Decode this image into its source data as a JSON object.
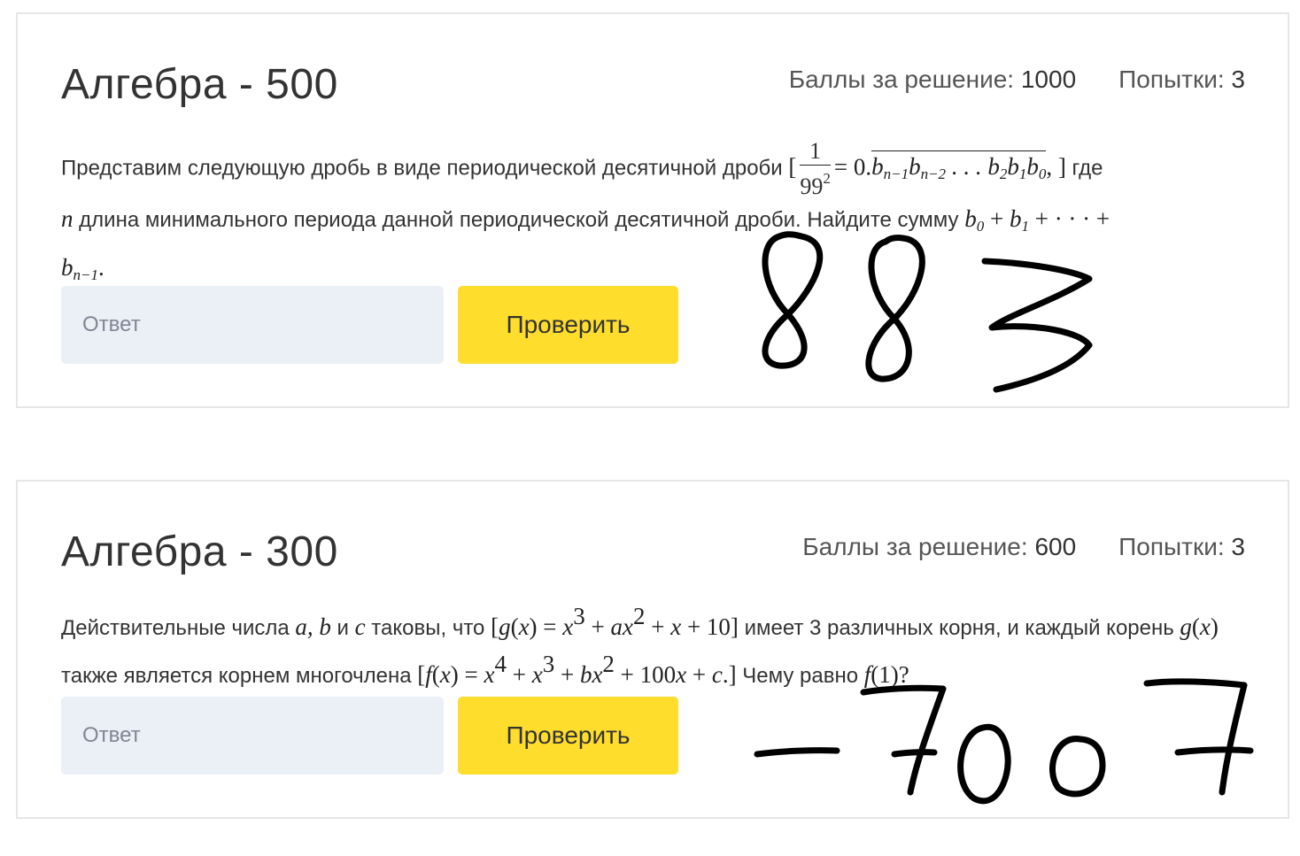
{
  "tasks": [
    {
      "title": "Алгебра - 500",
      "points_label": "Баллы за решение:",
      "points_value": "1000",
      "attempts_label": "Попытки:",
      "attempts_value": "3",
      "text": {
        "t1": "Представим следующую дробь в виде периодической десятичной дроби ",
        "t2": " где",
        "t3": " длина минимального периода данной периодической десятичной дроби. Найдите сумму "
      },
      "answer_placeholder": "Ответ",
      "check_label": "Проверить",
      "handwritten_answer": "883"
    },
    {
      "title": "Алгебра - 300",
      "points_label": "Баллы за решение:",
      "points_value": "600",
      "attempts_label": "Попытки:",
      "attempts_value": "3",
      "text": {
        "t1": "Действительные числа ",
        "t2": " и ",
        "t3": " таковы, что ",
        "t4": " имеет 3 различных корня, и каждый корень ",
        "t5": " также является корнем многочлена ",
        "t6": " Чему равно "
      },
      "answer_placeholder": "Ответ",
      "check_label": "Проверить",
      "handwritten_answer": "-7007"
    }
  ]
}
